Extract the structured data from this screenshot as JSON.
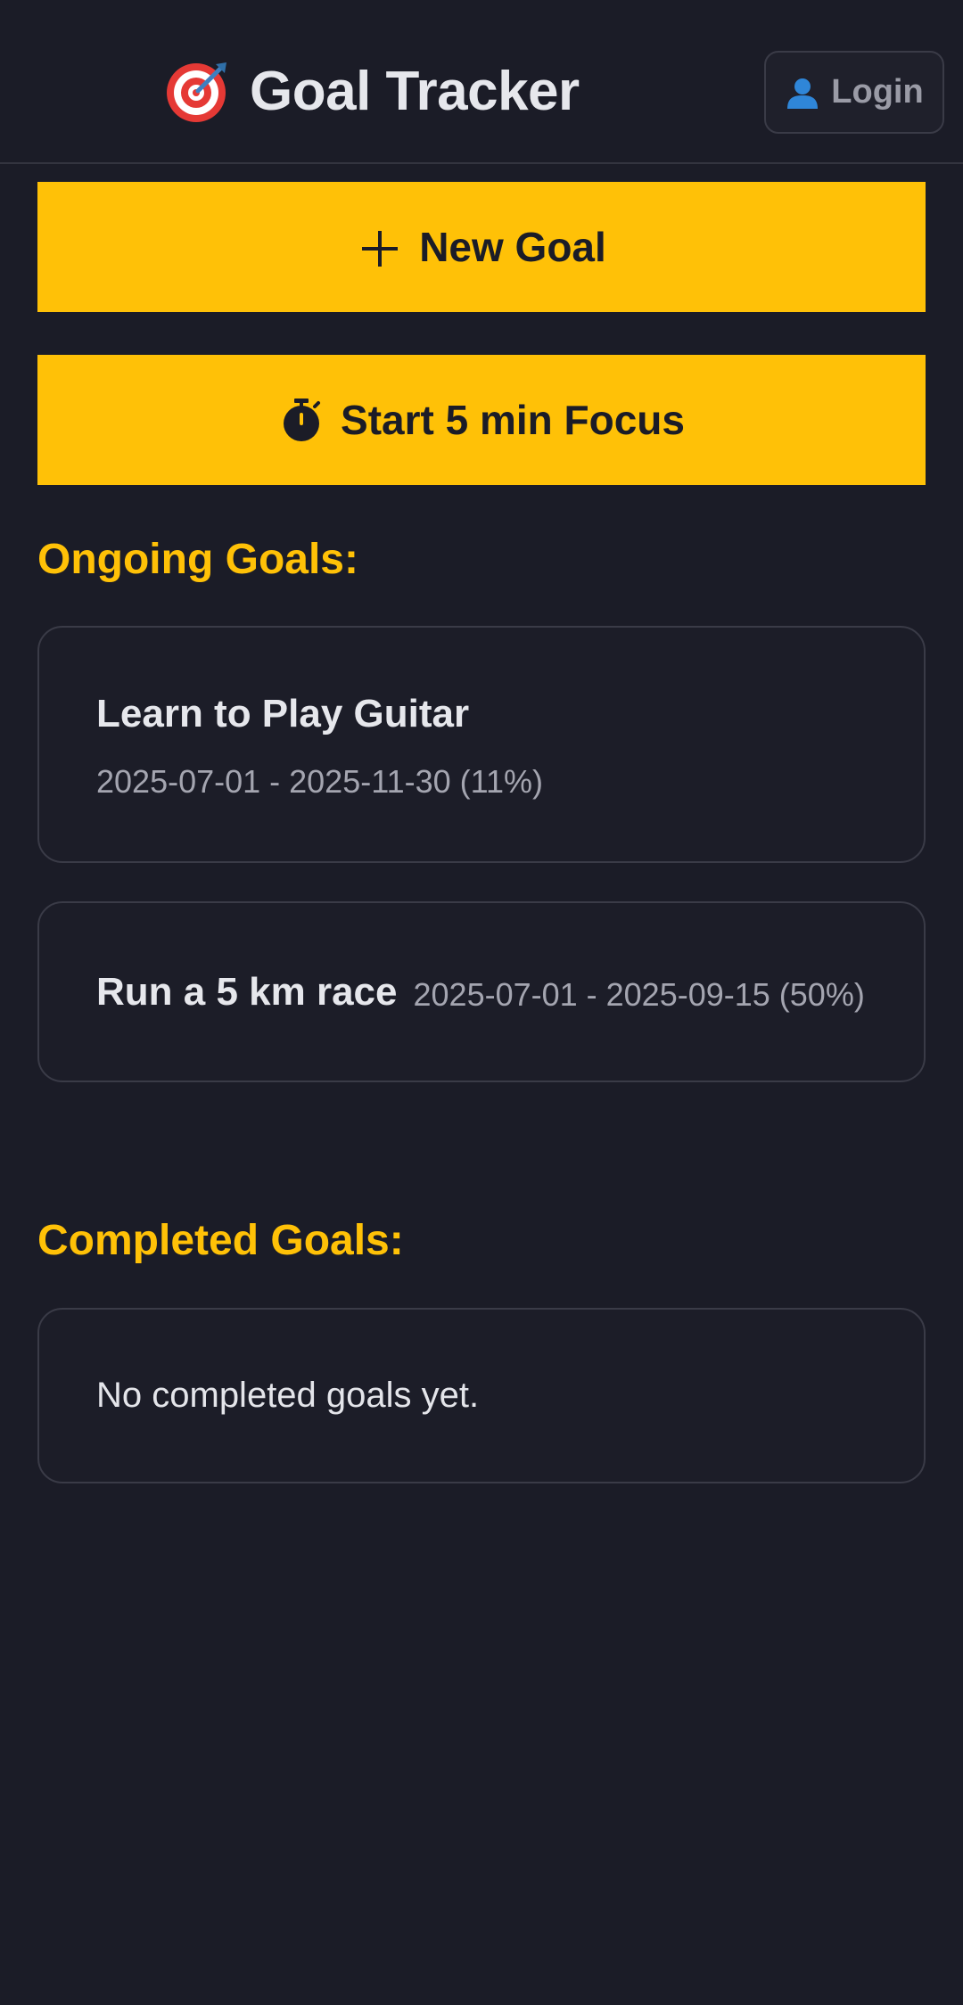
{
  "header": {
    "title": "Goal Tracker",
    "title_icon": "target-icon",
    "login_label": "Login",
    "login_icon": "user-icon"
  },
  "actions": {
    "new_goal_label": "New Goal",
    "new_goal_icon": "plus-icon",
    "focus_label": "Start 5 min Focus",
    "focus_icon": "stopwatch-icon"
  },
  "ongoing": {
    "title": "Ongoing Goals:",
    "goals": [
      {
        "name": "Learn to Play Guitar",
        "dates": "2025-07-01 - 2025-11-30 (11%)"
      },
      {
        "name": "Run a 5 km race",
        "dates": "2025-07-01 - 2025-09-15 (50%)"
      }
    ]
  },
  "completed": {
    "title": "Completed Goals:",
    "empty_text": "No completed goals yet."
  },
  "colors": {
    "background": "#1b1c27",
    "accent": "#ffc107",
    "card_border": "#3a3b47",
    "muted_text": "#a4a5b0"
  }
}
